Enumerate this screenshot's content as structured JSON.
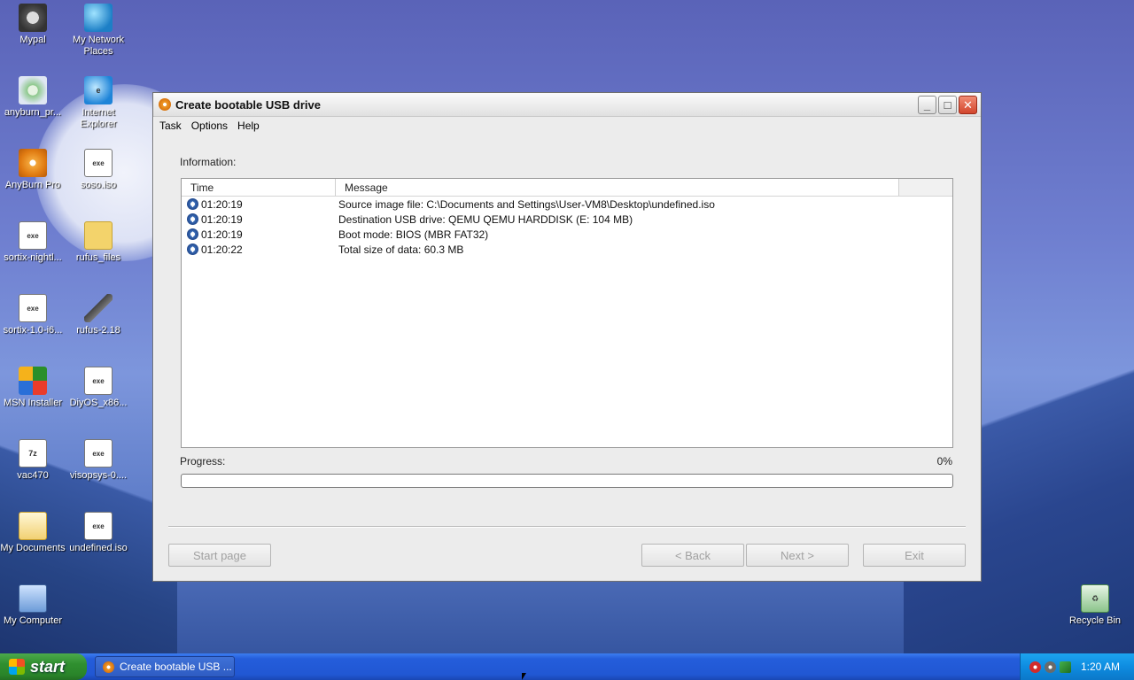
{
  "desktop": {
    "icons": [
      {
        "label": "Mypal",
        "glyph": "racoon"
      },
      {
        "label": "My Network Places",
        "glyph": "globe"
      },
      {
        "label": "anyburn_pr...",
        "glyph": "anyburn"
      },
      {
        "label": "Internet Explorer",
        "glyph": "ie"
      },
      {
        "label": "AnyBurn Pro",
        "glyph": "disc"
      },
      {
        "label": "soso.iso",
        "glyph": "doc"
      },
      {
        "label": "sortix-nightl...",
        "glyph": "doc"
      },
      {
        "label": "rufus_files",
        "glyph": "folder"
      },
      {
        "label": "sortix-1.0-i6...",
        "glyph": "doc"
      },
      {
        "label": "rufus-2.18",
        "glyph": "usb"
      },
      {
        "label": "MSN Installer",
        "glyph": "msn"
      },
      {
        "label": "DiyOS_x86...",
        "glyph": "doc"
      },
      {
        "label": "vac470",
        "glyph": "7z"
      },
      {
        "label": "visopsys-0....",
        "glyph": "doc"
      },
      {
        "label": "My Documents",
        "glyph": "mail"
      },
      {
        "label": "undefined.iso",
        "glyph": "doc"
      },
      {
        "label": "My Computer",
        "glyph": "pc"
      },
      {
        "label": "Recycle Bin",
        "glyph": "bin"
      }
    ]
  },
  "window": {
    "title": "Create bootable USB drive",
    "menu": [
      "Task",
      "Options",
      "Help"
    ],
    "information_label": "Information:",
    "log": {
      "columns": [
        "Time",
        "Message"
      ],
      "rows": [
        {
          "time": "01:20:19",
          "message": "Source image file: C:\\Documents and Settings\\User-VM8\\Desktop\\undefined.iso"
        },
        {
          "time": "01:20:19",
          "message": "Destination USB drive: QEMU QEMU HARDDISK (E:  104 MB)"
        },
        {
          "time": "01:20:19",
          "message": "Boot mode: BIOS (MBR FAT32)"
        },
        {
          "time": "01:20:22",
          "message": "Total size of data: 60.3 MB"
        }
      ]
    },
    "progress": {
      "label": "Progress:",
      "percent_text": "0%",
      "value": 0
    },
    "buttons": {
      "start_page": "Start page",
      "back": "< Back",
      "next": "Next >",
      "exit": "Exit"
    }
  },
  "taskbar": {
    "start_label": "start",
    "task_item": "Create bootable USB ...",
    "clock": "1:20 AM"
  }
}
